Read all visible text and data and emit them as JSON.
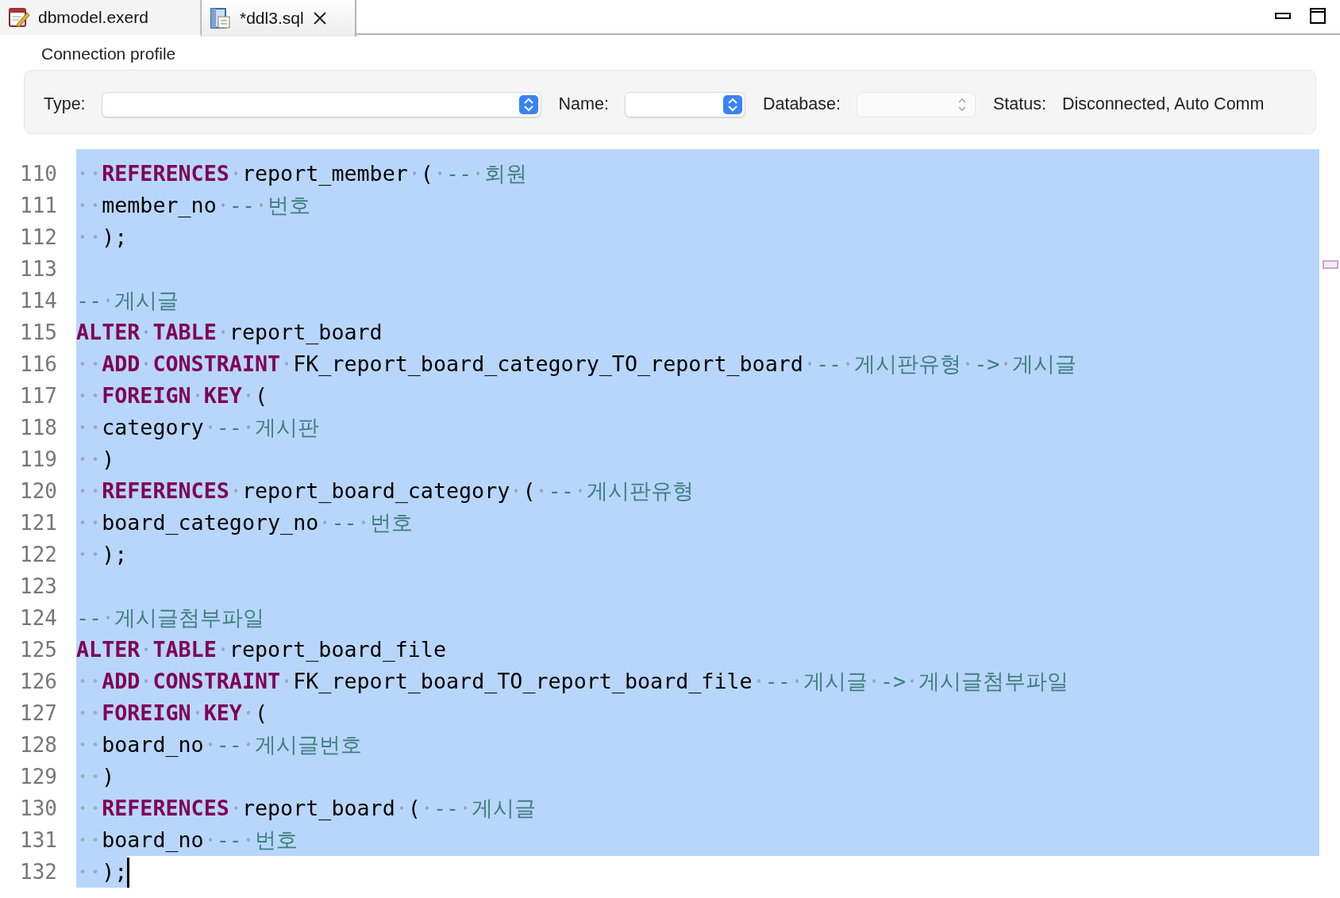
{
  "tabs": [
    {
      "label": "dbmodel.exerd",
      "kind": "model",
      "selected": false,
      "closable": false
    },
    {
      "label": "*ddl3.sql",
      "kind": "sql",
      "selected": true,
      "closable": true
    }
  ],
  "connection_profile": {
    "title": "Connection profile",
    "fields": [
      {
        "label": "Type:",
        "kind": "dropdown",
        "disabled": false
      },
      {
        "label": "Name:",
        "kind": "dropdown",
        "disabled": false
      },
      {
        "label": "Database:",
        "kind": "dropdown",
        "disabled": true
      },
      {
        "label": "Status:",
        "kind": "text",
        "value": "Disconnected, Auto Comm"
      }
    ]
  },
  "editor": {
    "lines": [
      {
        "number": "110",
        "selected": true,
        "segments": [
          {
            "kind": "keyword",
            "text": "  REFERENCES"
          },
          {
            "kind": "plain",
            "text": " report_member ("
          },
          {
            "kind": "comment",
            "text": " -- 회원"
          }
        ]
      },
      {
        "number": "111",
        "selected": true,
        "segments": [
          {
            "kind": "plain",
            "text": "  member_no"
          },
          {
            "kind": "comment",
            "text": " -- 번호"
          }
        ]
      },
      {
        "number": "112",
        "selected": true,
        "segments": [
          {
            "kind": "plain",
            "text": "  );"
          }
        ]
      },
      {
        "number": "113",
        "selected": true
      },
      {
        "number": "114",
        "selected": true,
        "segments": [
          {
            "kind": "comment",
            "text": "-- 게시글"
          }
        ]
      },
      {
        "number": "115",
        "selected": true,
        "segments": [
          {
            "kind": "keyword",
            "text": "ALTER TABLE"
          },
          {
            "kind": "plain",
            "text": " report_board"
          }
        ]
      },
      {
        "number": "116",
        "selected": true,
        "segments": [
          {
            "kind": "keyword",
            "text": "  ADD CONSTRAINT"
          },
          {
            "kind": "plain",
            "text": " FK_report_board_category_TO_report_board"
          },
          {
            "kind": "comment",
            "text": " -- 게시판유형 -> 게시글"
          }
        ]
      },
      {
        "number": "117",
        "selected": true,
        "segments": [
          {
            "kind": "keyword",
            "text": "  FOREIGN KEY"
          },
          {
            "kind": "plain",
            "text": " ("
          }
        ]
      },
      {
        "number": "118",
        "selected": true,
        "segments": [
          {
            "kind": "plain",
            "text": "  category"
          },
          {
            "kind": "comment",
            "text": " -- 게시판"
          }
        ]
      },
      {
        "number": "119",
        "selected": true,
        "segments": [
          {
            "kind": "plain",
            "text": "  )"
          }
        ]
      },
      {
        "number": "120",
        "selected": true,
        "segments": [
          {
            "kind": "keyword",
            "text": "  REFERENCES"
          },
          {
            "kind": "plain",
            "text": " report_board_category ("
          },
          {
            "kind": "comment",
            "text": " -- 게시판유형"
          }
        ]
      },
      {
        "number": "121",
        "selected": true,
        "segments": [
          {
            "kind": "plain",
            "text": "  board_category_no"
          },
          {
            "kind": "comment",
            "text": " -- 번호"
          }
        ]
      },
      {
        "number": "122",
        "selected": true,
        "segments": [
          {
            "kind": "plain",
            "text": "  );"
          }
        ]
      },
      {
        "number": "123",
        "selected": true
      },
      {
        "number": "124",
        "selected": true,
        "segments": [
          {
            "kind": "comment",
            "text": "-- 게시글첨부파일"
          }
        ]
      },
      {
        "number": "125",
        "selected": true,
        "segments": [
          {
            "kind": "keyword",
            "text": "ALTER TABLE"
          },
          {
            "kind": "plain",
            "text": " report_board_file"
          }
        ]
      },
      {
        "number": "126",
        "selected": true,
        "segments": [
          {
            "kind": "keyword",
            "text": "  ADD CONSTRAINT"
          },
          {
            "kind": "plain",
            "text": " FK_report_board_TO_report_board_file"
          },
          {
            "kind": "comment",
            "text": " -- 게시글 -> 게시글첨부파일"
          }
        ]
      },
      {
        "number": "127",
        "selected": true,
        "segments": [
          {
            "kind": "keyword",
            "text": "  FOREIGN KEY"
          },
          {
            "kind": "plain",
            "text": " ("
          }
        ]
      },
      {
        "number": "128",
        "selected": true,
        "segments": [
          {
            "kind": "plain",
            "text": "  board_no"
          },
          {
            "kind": "comment",
            "text": " -- 게시글번호"
          }
        ]
      },
      {
        "number": "129",
        "selected": true,
        "segments": [
          {
            "kind": "plain",
            "text": "  )"
          }
        ]
      },
      {
        "number": "130",
        "selected": true,
        "segments": [
          {
            "kind": "keyword",
            "text": "  REFERENCES"
          },
          {
            "kind": "plain",
            "text": " report_board ("
          },
          {
            "kind": "comment",
            "text": " -- 게시글"
          }
        ]
      },
      {
        "number": "131",
        "selected": true,
        "segments": [
          {
            "kind": "plain",
            "text": "  board_no"
          },
          {
            "kind": "comment",
            "text": " -- 번호"
          }
        ]
      },
      {
        "number": "132",
        "selected": true,
        "cursor": true,
        "segments": [
          {
            "kind": "plain",
            "text": "  );"
          }
        ]
      }
    ]
  }
}
